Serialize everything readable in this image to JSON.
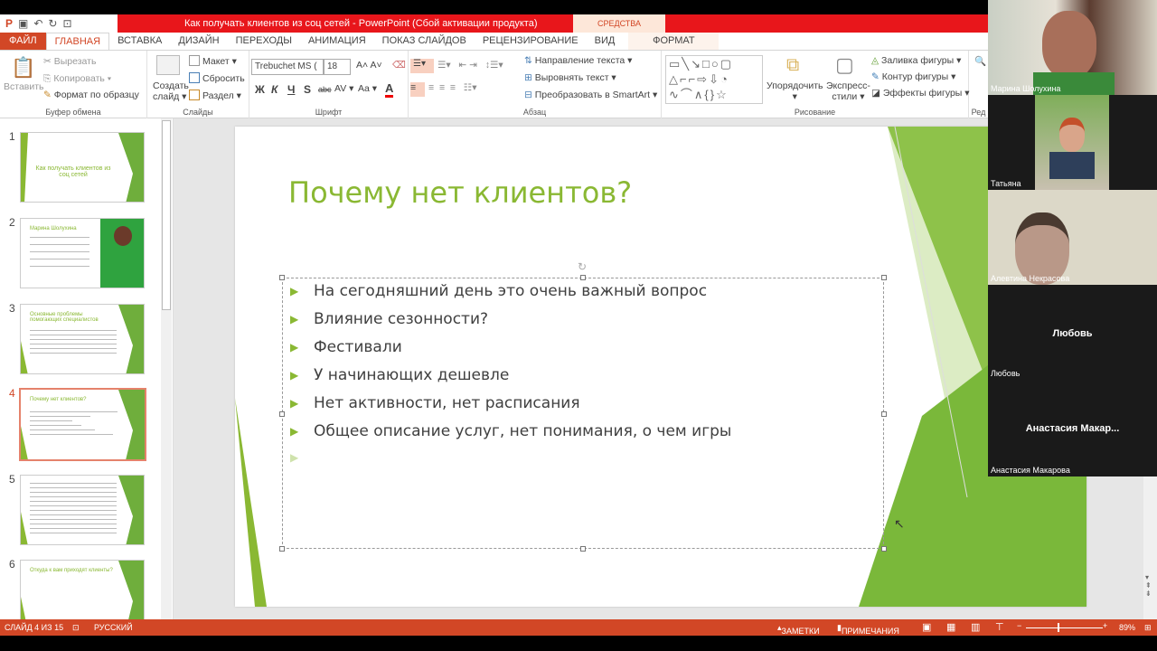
{
  "window": {
    "title": "Как получать клиентов из соц сетей -  PowerPoint (Сбой активации продукта)",
    "context_tab": "СРЕДСТВА РИСОВАНИЯ"
  },
  "tabs": [
    "ФАЙЛ",
    "ГЛАВНАЯ",
    "ВСТАВКА",
    "ДИЗАЙН",
    "ПЕРЕХОДЫ",
    "АНИМАЦИЯ",
    "ПОКАЗ СЛАЙДОВ",
    "РЕЦЕНЗИРОВАНИЕ",
    "ВИД",
    "ФОРМАТ"
  ],
  "ribbon": {
    "clipboard": {
      "paste": "Вставить",
      "cut": "Вырезать",
      "copy": "Копировать",
      "format_painter": "Формат по образцу",
      "label": "Буфер обмена"
    },
    "slides": {
      "new_slide_1": "Создать",
      "new_slide_2": "слайд",
      "layout": "Макет",
      "reset": "Сбросить",
      "section": "Раздел",
      "label": "Слайды"
    },
    "font": {
      "name": "Trebuchet MS (",
      "size": "18",
      "bold": "Ж",
      "italic": "К",
      "underline": "Ч",
      "shadow": "S",
      "strike": "abc",
      "spacing": "AV",
      "case": "Aa",
      "color": "A",
      "label": "Шрифт"
    },
    "paragraph": {
      "text_direction": "Направление текста",
      "align_text": "Выровнять текст",
      "smartart": "Преобразовать в SmartArt",
      "label": "Абзац"
    },
    "drawing": {
      "arrange": "Упорядочить",
      "quick_styles_1": "Экспресс-",
      "quick_styles_2": "стили",
      "fill": "Заливка фигуры",
      "outline": "Контур фигуры",
      "effects": "Эффекты фигуры",
      "label": "Рисование"
    },
    "editing": {
      "label": "Ред"
    }
  },
  "thumbnails": [
    {
      "num": "1",
      "title": "Как получать клиентов из соц сетей"
    },
    {
      "num": "2",
      "title": "Марина Шолухина"
    },
    {
      "num": "3",
      "title": "Основные проблемы помогающих специалистов"
    },
    {
      "num": "4",
      "title": "Почему нет клиентов?"
    },
    {
      "num": "5",
      "title": ""
    },
    {
      "num": "6",
      "title": "Откуда к вам приходят клиенты?"
    }
  ],
  "slide": {
    "title": "Почему нет клиентов?",
    "bullets": [
      "На сегодняшний день это очень важный вопрос",
      "Влияние сезонности?",
      "Фестивали",
      "У начинающих дешевле",
      "Нет активности, нет расписания",
      "Общее описание услуг, нет понимания, о чем игры"
    ]
  },
  "status": {
    "slide": "СЛАЙД 4 ИЗ 15",
    "language": "РУССКИЙ",
    "notes": "ЗАМЕТКИ",
    "comments": "ПРИМЕЧАНИЯ",
    "zoom": "89%"
  },
  "participants": [
    {
      "name": "Марина Шолухина",
      "video": true
    },
    {
      "name": "Татьяна",
      "video": true
    },
    {
      "name": "Алевтина Некрасова",
      "video": true
    },
    {
      "name": "Любовь",
      "display": "Любовь",
      "video": false
    },
    {
      "name": "Анастасия Макарова",
      "display": "Анастасия  Макар...",
      "video": false
    }
  ],
  "colors": {
    "accent": "#d24726",
    "title_bar": "#e8161b",
    "slide_green": "#8ab833"
  }
}
